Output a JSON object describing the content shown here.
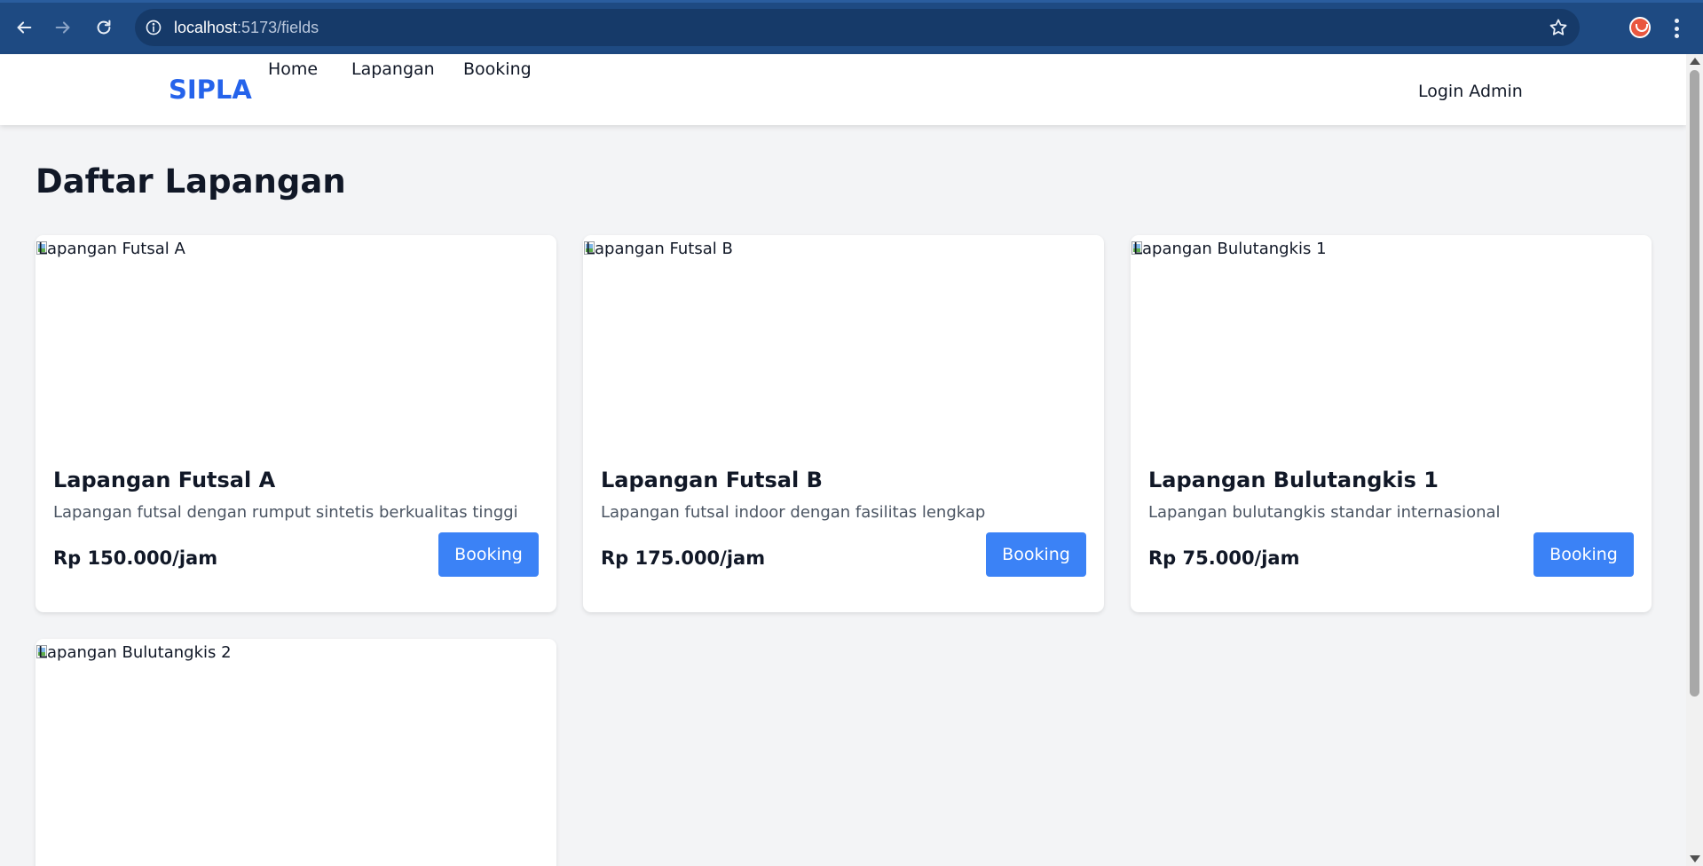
{
  "browser": {
    "url_host": "localhost",
    "url_path": ":5173/fields"
  },
  "navbar": {
    "brand": "SIPLA",
    "links": [
      "Home",
      "Lapangan",
      "Booking"
    ],
    "login": "Login Admin"
  },
  "page": {
    "title": "Daftar Lapangan"
  },
  "fields": [
    {
      "image_alt": "Lapangan Futsal A",
      "name": "Lapangan Futsal A",
      "description": "Lapangan futsal dengan rumput sintetis berkualitas tinggi",
      "price": "Rp 150.000/jam",
      "button": "Booking"
    },
    {
      "image_alt": "Lapangan Futsal B",
      "name": "Lapangan Futsal B",
      "description": "Lapangan futsal indoor dengan fasilitas lengkap",
      "price": "Rp 175.000/jam",
      "button": "Booking"
    },
    {
      "image_alt": "Lapangan Bulutangkis 1",
      "name": "Lapangan Bulutangkis 1",
      "description": "Lapangan bulutangkis standar internasional",
      "price": "Rp 75.000/jam",
      "button": "Booking"
    },
    {
      "image_alt": "Lapangan Bulutangkis 2"
    }
  ],
  "colors": {
    "brand": "#2563eb",
    "button": "#3b82f6",
    "page_bg": "#f3f4f6",
    "chrome_bg": "#1e4a82"
  },
  "icons": [
    "back-arrow-icon",
    "forward-arrow-icon",
    "reload-icon",
    "site-info-icon",
    "bookmark-star-icon",
    "profile-avatar-icon",
    "kebab-menu-icon",
    "broken-image-icon"
  ]
}
